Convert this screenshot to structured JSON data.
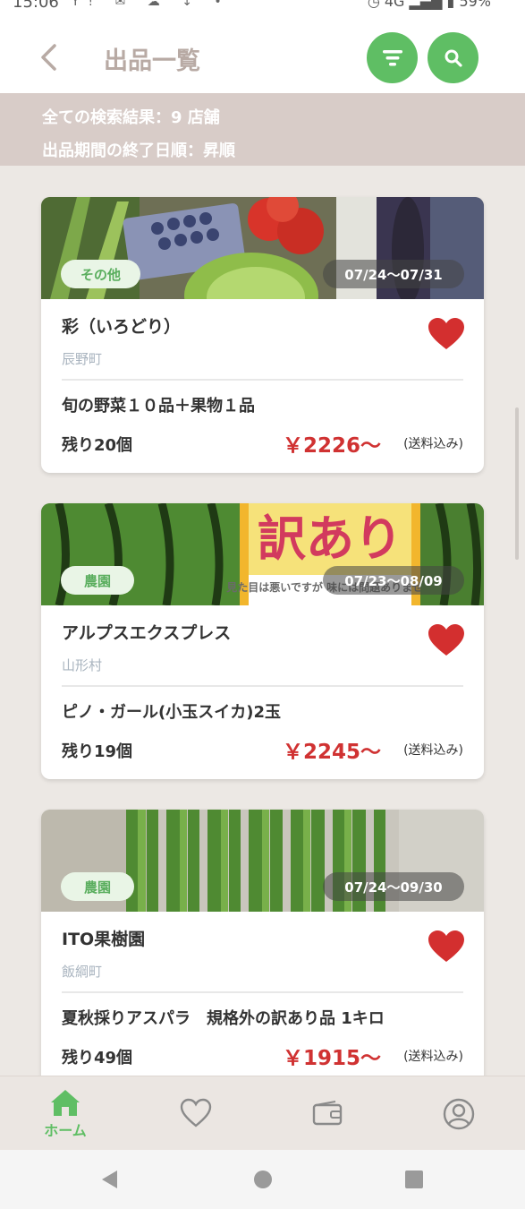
{
  "status_bar": {
    "time": "15:06",
    "left_icons": "Y!  ✉  ☁  ↓  •",
    "network": "4G",
    "battery": "59%"
  },
  "header": {
    "title": "出品一覧",
    "back_icon": "chevron-left-icon",
    "filter_icon": "filter-icon",
    "search_icon": "search-icon",
    "accent_color": "#5fbe64"
  },
  "info": {
    "results": "全ての検索結果：9 店舗",
    "sort": "出品期間の終了日順：昇順"
  },
  "listings": [
    {
      "tag": "その他",
      "dates": "07/24〜07/31",
      "shop": "彩（いろどり）",
      "area": "辰野町",
      "product": "旬の野菜１０品＋果物１品",
      "stock": "残り20個",
      "price": "￥2226〜",
      "shipping": "(送料込み)",
      "favorite": true
    },
    {
      "tag": "農園",
      "dates": "07/23〜08/09",
      "shop": "アルプスエクスプレス",
      "area": "山形村",
      "product": "ピノ・ガール(小玉スイカ)2玉",
      "stock": "残り19個",
      "price": "￥2245〜",
      "shipping": "(送料込み)",
      "favorite": true,
      "image_text": "訳あり",
      "image_subtext": "見た目は悪いですが 味には問題ありません"
    },
    {
      "tag": "農園",
      "dates": "07/24〜09/30",
      "shop": "ITO果樹園",
      "area": "飯綱町",
      "product": "夏秋採りアスパラ　規格外の訳あり品 1キロ",
      "stock": "残り49個",
      "price": "￥1915〜",
      "shipping": "(送料込み)",
      "favorite": true
    }
  ],
  "bottom_nav": {
    "home_label": "ホーム",
    "items": [
      "home-icon",
      "heart-outline-icon",
      "wallet-icon",
      "account-icon"
    ]
  },
  "colors": {
    "price": "#d03232",
    "heart": "#d32f2f",
    "tag_bg": "#e9f5e6",
    "info_band": "#d8ccc8"
  }
}
